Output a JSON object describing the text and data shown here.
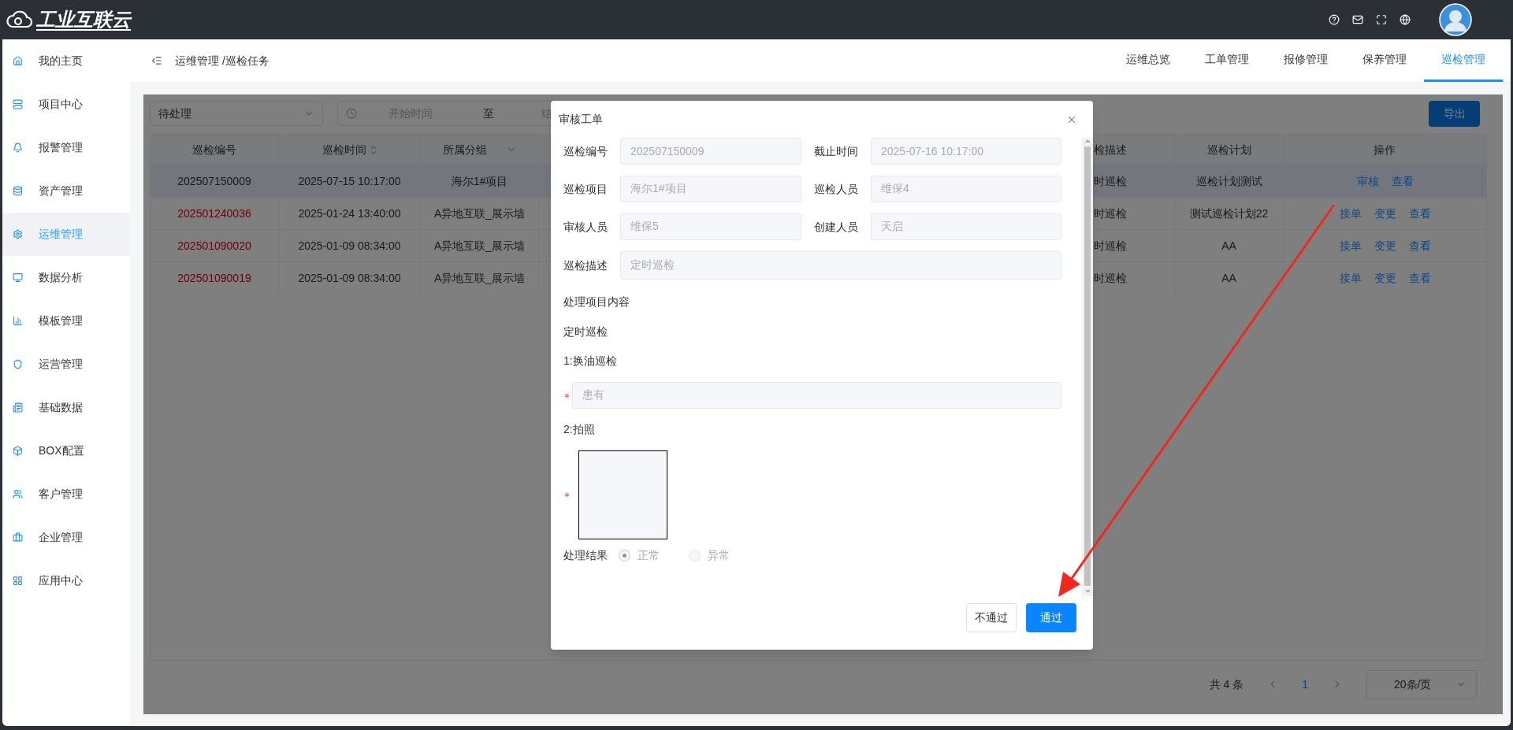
{
  "app": {
    "logo_text": "工业互联云"
  },
  "sidebar": {
    "items": [
      {
        "label": "我的主页",
        "selected": false
      },
      {
        "label": "项目中心",
        "selected": false
      },
      {
        "label": "报警管理",
        "selected": false
      },
      {
        "label": "资产管理",
        "selected": false
      },
      {
        "label": "运维管理",
        "selected": true
      },
      {
        "label": "数据分析",
        "selected": false
      },
      {
        "label": "模板管理",
        "selected": false
      },
      {
        "label": "运营管理",
        "selected": false
      },
      {
        "label": "基础数据",
        "selected": false
      },
      {
        "label": "BOX配置",
        "selected": false
      },
      {
        "label": "客户管理",
        "selected": false
      },
      {
        "label": "企业管理",
        "selected": false
      },
      {
        "label": "应用中心",
        "selected": false
      }
    ]
  },
  "breadcrumb": "运维管理 /巡检任务",
  "tabs": [
    {
      "label": "运维总览",
      "selected": false
    },
    {
      "label": "工单管理",
      "selected": false
    },
    {
      "label": "报修管理",
      "selected": false
    },
    {
      "label": "保养管理",
      "selected": false
    },
    {
      "label": "巡检管理",
      "selected": true
    }
  ],
  "filters": {
    "status": "待处理",
    "start_placeholder": "开始时间",
    "separator": "至",
    "end_placeholder": "结",
    "export_button": "导出"
  },
  "table": {
    "columns": [
      {
        "label": "巡检编号",
        "kind": "plain"
      },
      {
        "label": "巡检时间",
        "kind": "sort"
      },
      {
        "label": "所属分组",
        "kind": "filter"
      },
      {
        "label": "检描述",
        "kind": "plain"
      },
      {
        "label": "巡检计划",
        "kind": "plain"
      },
      {
        "label": "操作",
        "kind": "plain"
      }
    ],
    "rows": [
      {
        "id": "202507150009",
        "alert": false,
        "selected": true,
        "time": "2025-07-15 10:17:00",
        "group": "海尔1#项目",
        "description": "时巡检",
        "plan": "巡检计划测试",
        "actions": [
          "审核",
          "查看"
        ]
      },
      {
        "id": "202501240036",
        "alert": true,
        "selected": false,
        "time": "2025-01-24 13:40:00",
        "group": "A异地互联_展示墙",
        "description": "时巡检",
        "plan": "测试巡检计划22",
        "actions": [
          "接单",
          "变更",
          "查看"
        ]
      },
      {
        "id": "202501090020",
        "alert": true,
        "selected": false,
        "time": "2025-01-09 08:34:00",
        "group": "A异地互联_展示墙",
        "description": "时巡检",
        "plan": "AA",
        "actions": [
          "接单",
          "变更",
          "查看"
        ]
      },
      {
        "id": "202501090019",
        "alert": true,
        "selected": false,
        "time": "2025-01-09 08:34:00",
        "group": "A异地互联_展示墙",
        "description": "时巡检",
        "plan": "AA",
        "actions": [
          "接单",
          "变更",
          "查看"
        ]
      }
    ]
  },
  "pagination": {
    "total": "共 4 条",
    "page": "1",
    "page_size": "20条/页"
  },
  "dialog": {
    "title": "审核工单",
    "fields": [
      {
        "label": "巡检编号",
        "value": "202507150009"
      },
      {
        "label": "截止时间",
        "value": "2025-07-16 10:17:00"
      },
      {
        "label": "巡检项目",
        "value": "海尔1#项目"
      },
      {
        "label": "巡检人员",
        "value": "维保4"
      },
      {
        "label": "审核人员",
        "value": "维保5"
      },
      {
        "label": "创建人员",
        "value": "天启"
      }
    ],
    "description": {
      "label": "巡检描述",
      "value": "定时巡检"
    },
    "section_title": "处理项目内容",
    "content_title": "定时巡检",
    "items": [
      {
        "kind": "text",
        "label": "1:换油巡检",
        "required": true,
        "value": "患有"
      },
      {
        "kind": "photo",
        "label": "2:拍照",
        "required": true
      }
    ],
    "result": {
      "label": "处理结果",
      "options": [
        {
          "label": "正常",
          "selected": true
        },
        {
          "label": "异常",
          "selected": false
        }
      ]
    },
    "buttons": {
      "reject": "不通过",
      "approve": "通过"
    }
  }
}
